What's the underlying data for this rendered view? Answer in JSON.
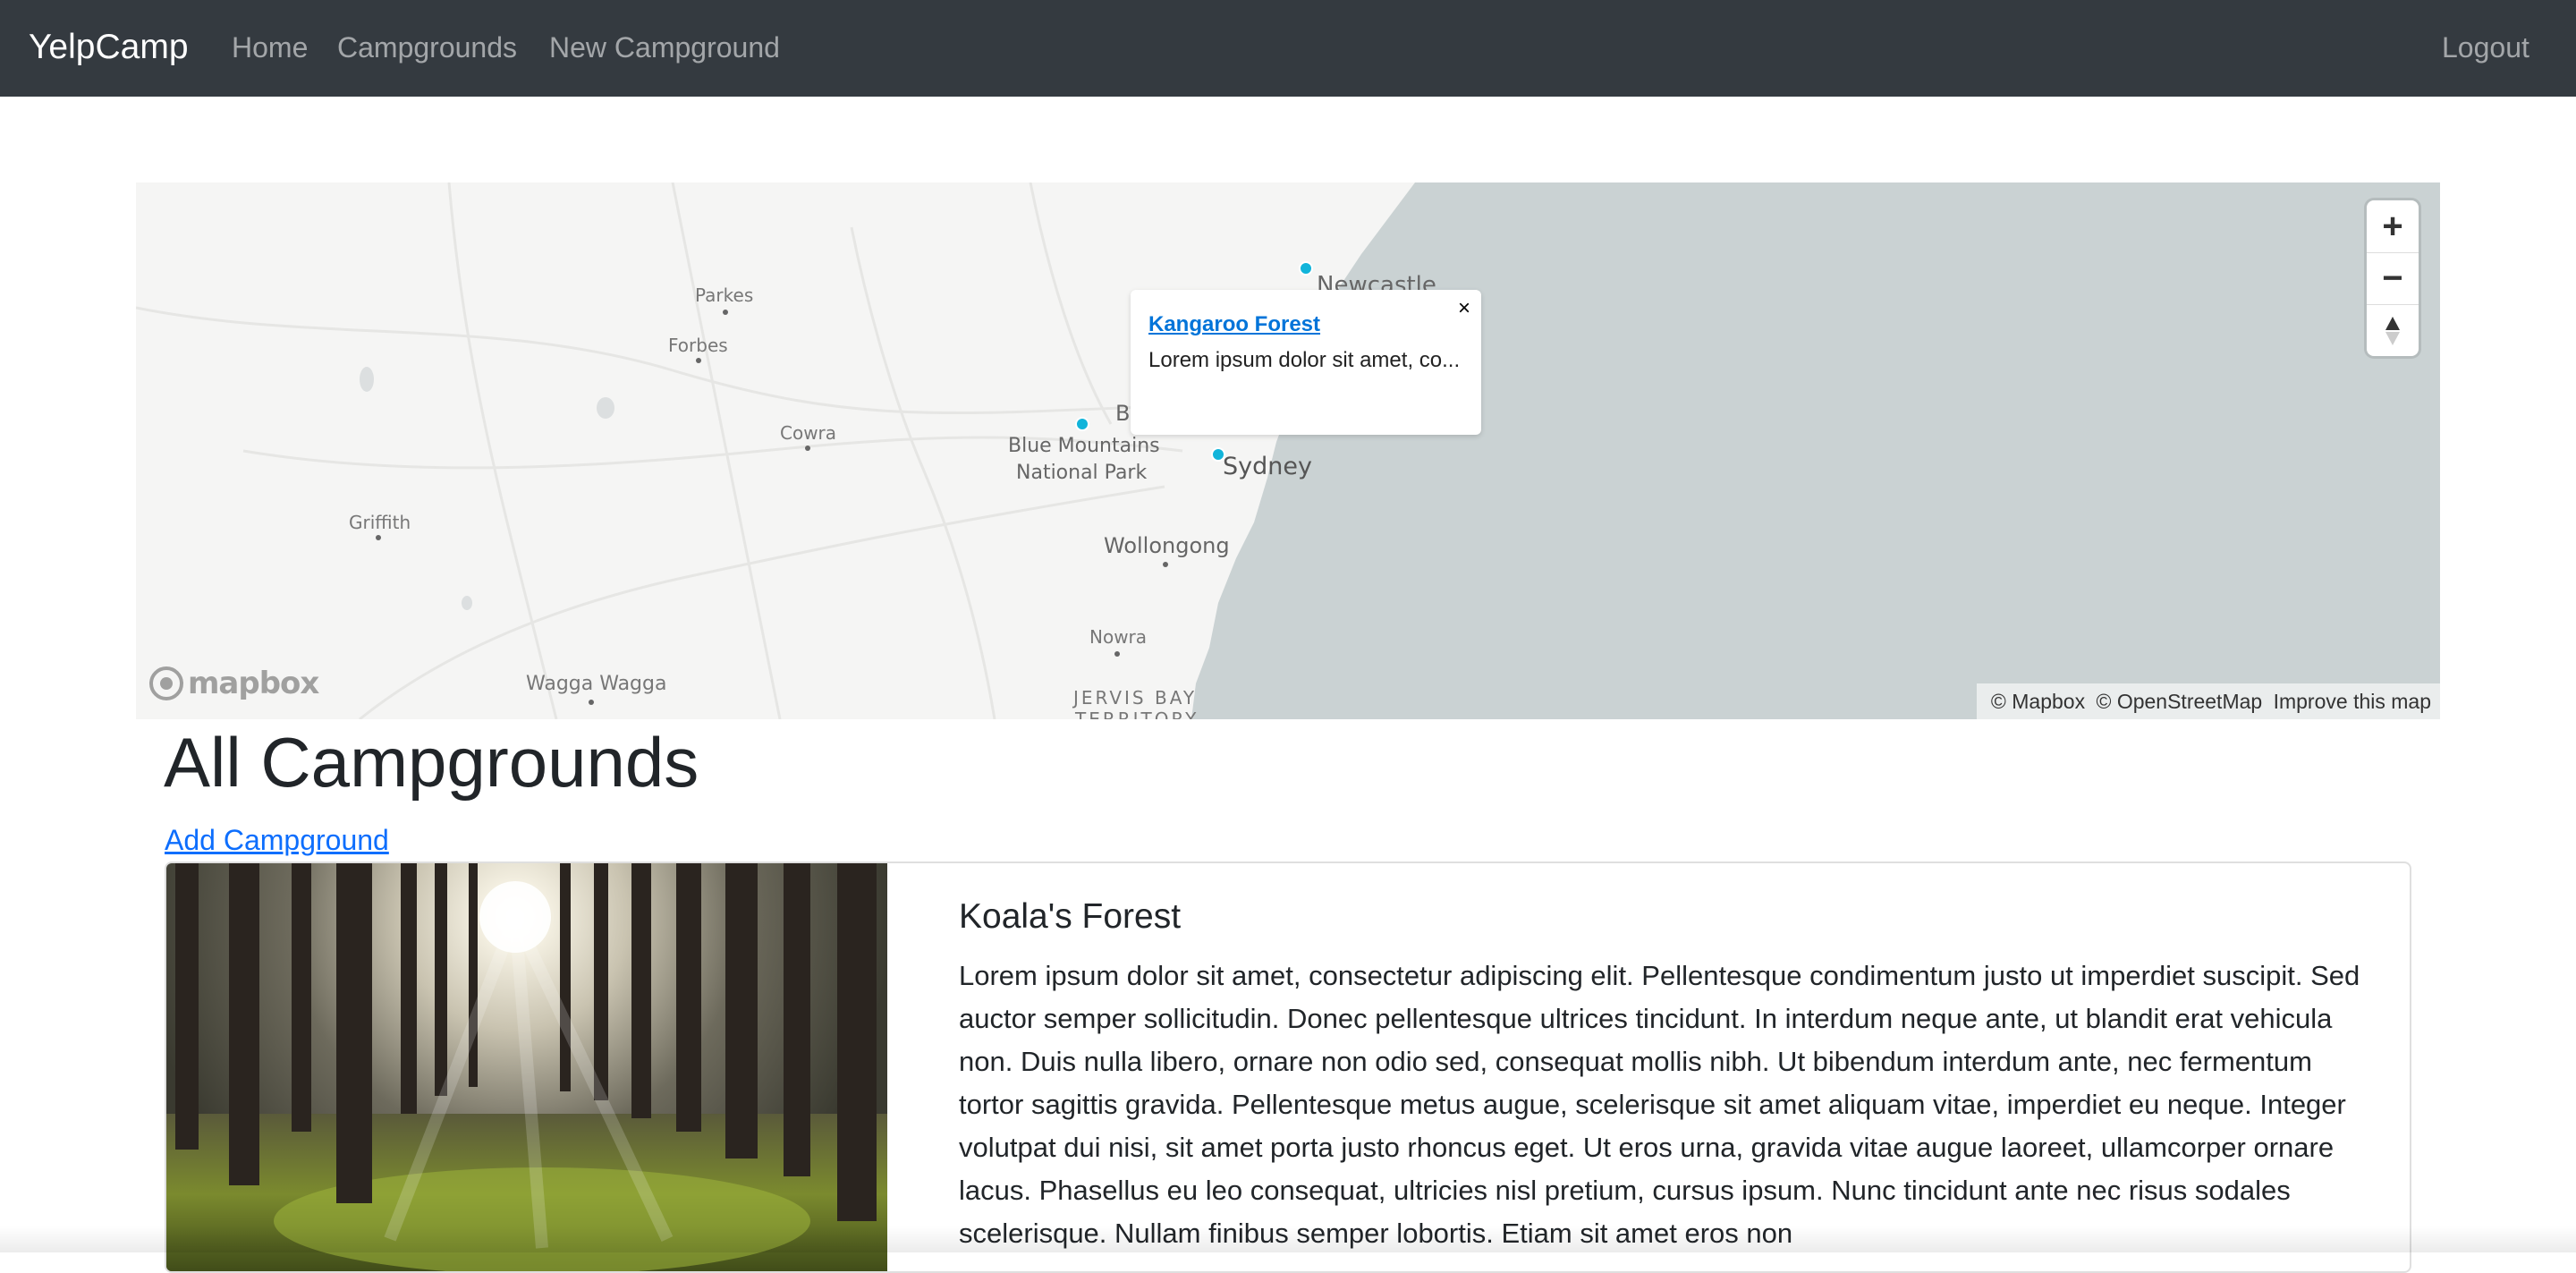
{
  "navbar": {
    "brand": "YelpCamp",
    "links": [
      "Home",
      "Campgrounds",
      "New Campground"
    ],
    "logout": "Logout"
  },
  "map": {
    "labels": {
      "newcastle": "Newcastle",
      "parkes": "Parkes",
      "forbes": "Forbes",
      "cowra": "Cowra",
      "blue_mountains_1": "Blue Mountains",
      "blue_mountains_2": "National Park",
      "b_partial": "B",
      "sydney": "Sydney",
      "wollongong": "Wollongong",
      "griffith": "Griffith",
      "nowra": "Nowra",
      "wagga": "Wagga Wagga",
      "jervis_1": "JERVIS BAY",
      "jervis_2": "TERRITORY"
    },
    "popup": {
      "title": "Kangaroo Forest",
      "text": "Lorem ipsum dolor sit amet, co...",
      "close": "×"
    },
    "controls": {
      "zoom_in": "+",
      "zoom_out": "−"
    },
    "logo": "mapbox",
    "attribution": {
      "mapbox": "© Mapbox",
      "osm": "© OpenStreetMap",
      "improve": "Improve this map"
    },
    "colors": {
      "land": "#f5f5f4",
      "water": "#cad2d3",
      "marker": "#11b4da"
    }
  },
  "page": {
    "title": "All Campgrounds",
    "add_link": "Add Campground"
  },
  "campgrounds": [
    {
      "title": "Koala's Forest",
      "description": "Lorem ipsum dolor sit amet, consectetur adipiscing elit. Pellentesque condimentum justo ut imperdiet suscipit. Sed auctor semper sollicitudin. Donec pellentesque ultrices tincidunt. In interdum neque ante, ut blandit erat vehicula non. Duis nulla libero, ornare non odio sed, consequat mollis nibh. Ut bibendum interdum ante, nec fermentum tortor sagittis gravida. Pellentesque metus augue, scelerisque sit amet aliquam vitae, imperdiet eu neque. Integer volutpat dui nisi, sit amet porta justo rhoncus eget. Ut eros urna, gravida vitae augue laoreet, ullamcorper ornare lacus. Phasellus eu leo consequat, ultricies nisl pretium, cursus ipsum. Nunc tincidunt ante nec risus sodales scelerisque. Nullam finibus semper lobortis. Etiam sit amet eros non",
      "image": "forest-sunlight"
    }
  ]
}
